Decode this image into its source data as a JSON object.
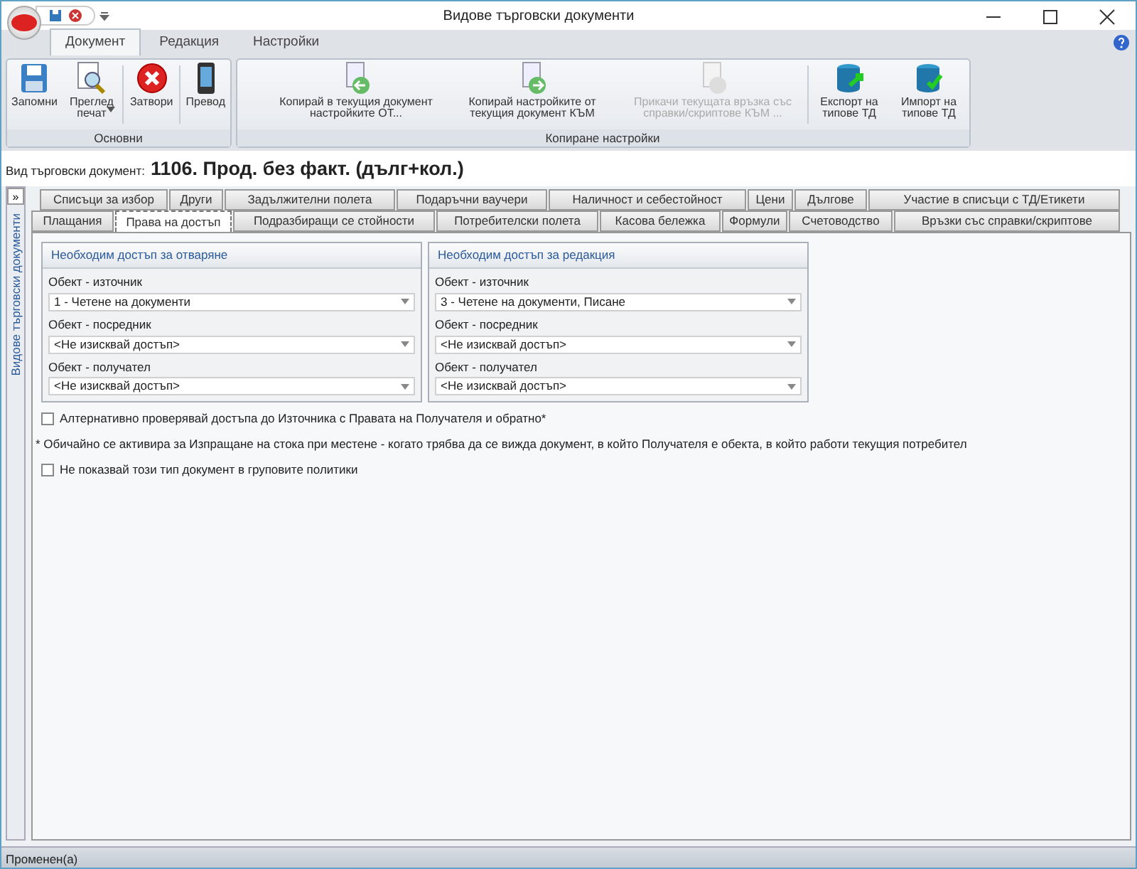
{
  "window": {
    "title": "Видове търговски документи"
  },
  "ribbon_tabs": [
    {
      "label": "Документ",
      "selected": true
    },
    {
      "label": "Редакция",
      "selected": false
    },
    {
      "label": "Настройки",
      "selected": false
    }
  ],
  "ribbon_groups": [
    {
      "label": "Основни",
      "buttons": [
        {
          "kind": "save",
          "label": "Запомни",
          "disabled": false
        },
        {
          "kind": "preview",
          "label": "Преглед печат",
          "dropdown": true,
          "disabled": false
        },
        {
          "kind": "close",
          "label": "Затвори",
          "disabled": false
        },
        {
          "kind": "phone",
          "label": "Превод",
          "disabled": false
        }
      ]
    },
    {
      "label": "Копиране настройки",
      "buttons": [
        {
          "kind": "copy-in",
          "label": "Копирай в текущия документ настройките ОТ...",
          "disabled": false
        },
        {
          "kind": "copy-out",
          "label": "Копирай настройките от текущия документ КЪМ",
          "disabled": false
        },
        {
          "kind": "attach",
          "label": "Прикачи текущата връзка със справки/скриптове КЪМ ...",
          "disabled": true
        },
        {
          "kind": "export",
          "label": "Експорт на типове ТД",
          "disabled": false
        },
        {
          "kind": "import",
          "label": "Импорт на типове ТД",
          "disabled": false
        }
      ]
    }
  ],
  "document_type": {
    "label": "Вид търговски документ:",
    "value": "1106. Прод. без факт. (дълг+кол.)"
  },
  "side_panel": {
    "button": "»",
    "label": "Видове търговски документи"
  },
  "tab_rows": [
    [
      {
        "label": "Списъци за избор",
        "selected": false
      },
      {
        "label": "Други",
        "selected": false
      },
      {
        "label": "Задължителни полета",
        "selected": false
      },
      {
        "label": "Подаръчни ваучери",
        "selected": false
      },
      {
        "label": "Наличност и себестойност",
        "selected": false
      },
      {
        "label": "Цени",
        "selected": false
      },
      {
        "label": "Дългове",
        "selected": false
      },
      {
        "label": "Участие в списъци с ТД/Етикети",
        "selected": false
      }
    ],
    [
      {
        "label": "Плащания",
        "selected": false
      },
      {
        "label": "Права на достъп",
        "selected": true
      },
      {
        "label": "Подразбиращи се стойности",
        "selected": false
      },
      {
        "label": "Потребителски полета",
        "selected": false
      },
      {
        "label": "Касова бележка",
        "selected": false
      },
      {
        "label": "Формули",
        "selected": false
      },
      {
        "label": "Счетоводство",
        "selected": false
      },
      {
        "label": "Връзки със справки/скриптове",
        "selected": false
      }
    ]
  ],
  "access_groups": [
    {
      "title": "Необходим достъп за отваряне",
      "fields": [
        {
          "label": "Обект - източник",
          "value": "1 - Четене на документи"
        },
        {
          "label": "Обект - посредник",
          "value": "<Не изисквай достъп>"
        },
        {
          "label": "Обект - получател",
          "value": "<Не изисквай достъп>"
        }
      ]
    },
    {
      "title": "Необходим достъп за редакция",
      "fields": [
        {
          "label": "Обект - източник",
          "value": "3 - Четене на документи, Писане"
        },
        {
          "label": "Обект - посредник",
          "value": "<Не изисквай достъп>"
        },
        {
          "label": "Обект - получател",
          "value": "<Не изисквай достъп>"
        }
      ]
    }
  ],
  "options": [
    {
      "kind": "checkbox",
      "label": "Алтернативно проверявай достъпа до Източника с Правата на Получателя и обратно*",
      "checked": false
    },
    {
      "kind": "note",
      "label": "* Обичайно се активира за Изпращане на стока при местене - когато трябва да се вижда документ, в който Получателя е обекта, в който работи текущия потребител"
    },
    {
      "kind": "checkbox",
      "label": "Не показвай този тип документ в груповите политики",
      "checked": false
    }
  ],
  "status_bar": {
    "text": "Променен(а)"
  }
}
